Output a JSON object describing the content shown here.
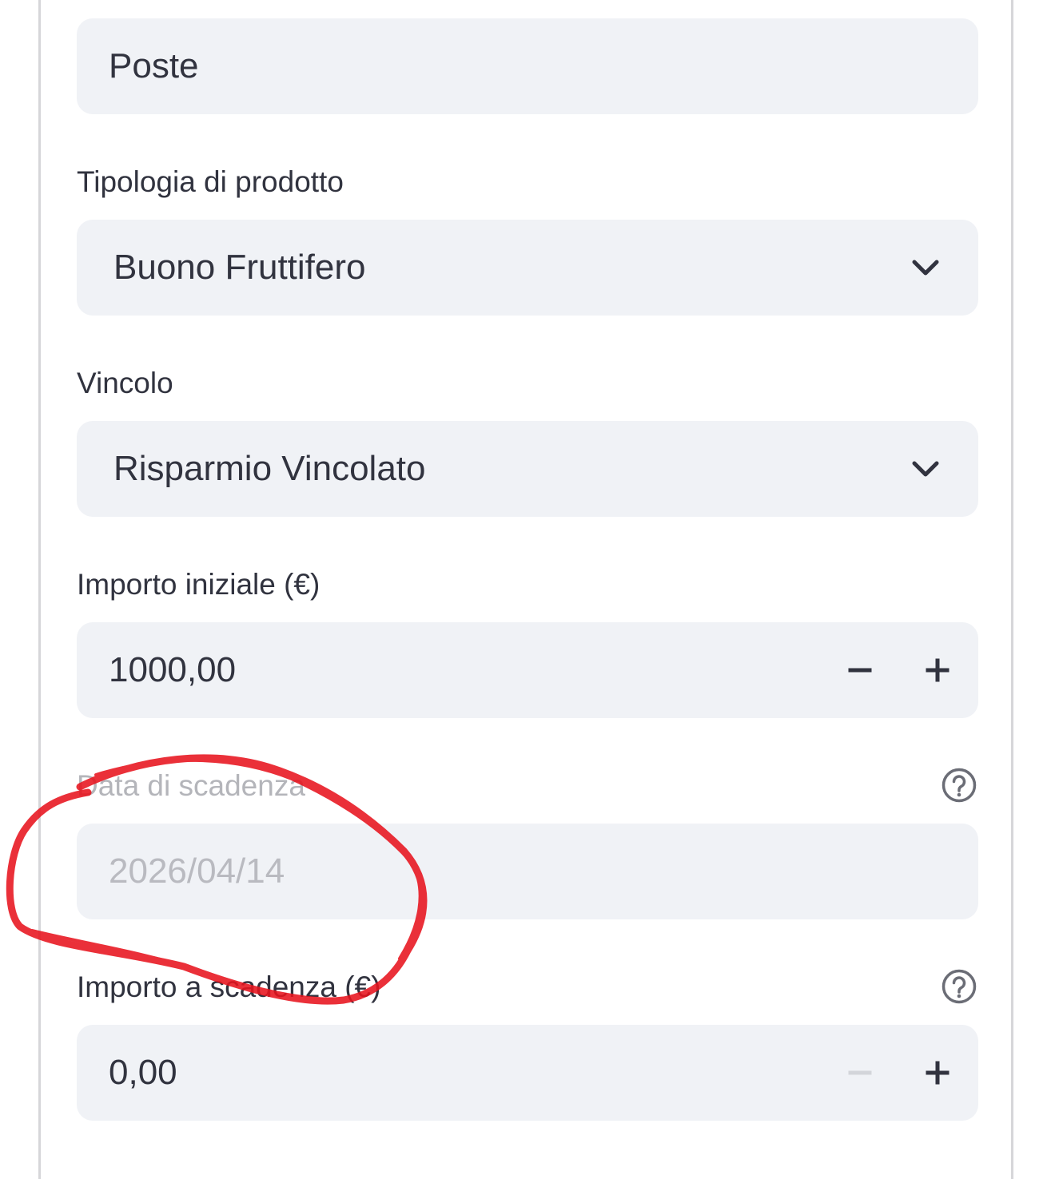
{
  "fields": {
    "provider": {
      "value": "Poste"
    },
    "product_type": {
      "label": "Tipologia di prodotto",
      "value": "Buono Fruttifero"
    },
    "constraint": {
      "label": "Vincolo",
      "value": "Risparmio Vincolato"
    },
    "initial_amount": {
      "label": "Importo iniziale (€)",
      "value": "1000,00"
    },
    "maturity_date": {
      "label": "Data di scadenza",
      "value": "2026/04/14",
      "disabled": true
    },
    "maturity_amount": {
      "label": "Importo a scadenza (€)",
      "value": "0,00"
    }
  },
  "icons": {
    "select_arrow": "chevron-down-icon",
    "decrement": "minus-icon",
    "increment": "plus-icon",
    "help": "question-circle-icon"
  },
  "colors": {
    "input_background": "#f0f2f6",
    "text": "#31333f",
    "disabled_text": "#b9bac0",
    "annotation": "#e8141e"
  }
}
